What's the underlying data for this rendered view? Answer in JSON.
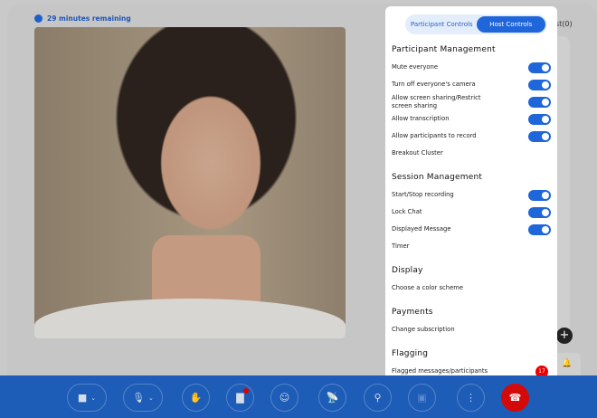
{
  "timer": {
    "text": "29 minutes remaining",
    "icon": "alarm-clock-icon"
  },
  "side": {
    "partial_label": "st(0)"
  },
  "panel": {
    "tabs": [
      {
        "label": "Participant Controls",
        "active": false
      },
      {
        "label": "Host Controls",
        "active": true
      }
    ],
    "sections": [
      {
        "title": "Participant Management",
        "items": [
          {
            "label": "Mute everyone",
            "toggle": true
          },
          {
            "label": "Turn off everyone's camera",
            "toggle": true
          },
          {
            "label": "Allow screen sharing/Restrict screen sharing",
            "toggle": true
          },
          {
            "label": "Allow transcription",
            "toggle": true
          },
          {
            "label": "Allow participants to record",
            "toggle": true
          },
          {
            "label": "Breakout Cluster"
          }
        ]
      },
      {
        "title": "Session Management",
        "items": [
          {
            "label": "Start/Stop recording",
            "toggle": true
          },
          {
            "label": "Lock Chat",
            "toggle": true
          },
          {
            "label": "Displayed Message",
            "toggle": true
          },
          {
            "label": "Timer"
          }
        ]
      },
      {
        "title": "Display",
        "items": [
          {
            "label": "Choose a color scheme"
          }
        ]
      },
      {
        "title": "Payments",
        "items": [
          {
            "label": "Change subscription"
          }
        ]
      },
      {
        "title": "Flagging",
        "items": [
          {
            "label": "Flagged messages/participants",
            "badge": "17"
          }
        ]
      }
    ]
  },
  "colors": {
    "accent": "#1f66da",
    "toolbar": "#1d5cb7",
    "end": "#d40a0a"
  }
}
